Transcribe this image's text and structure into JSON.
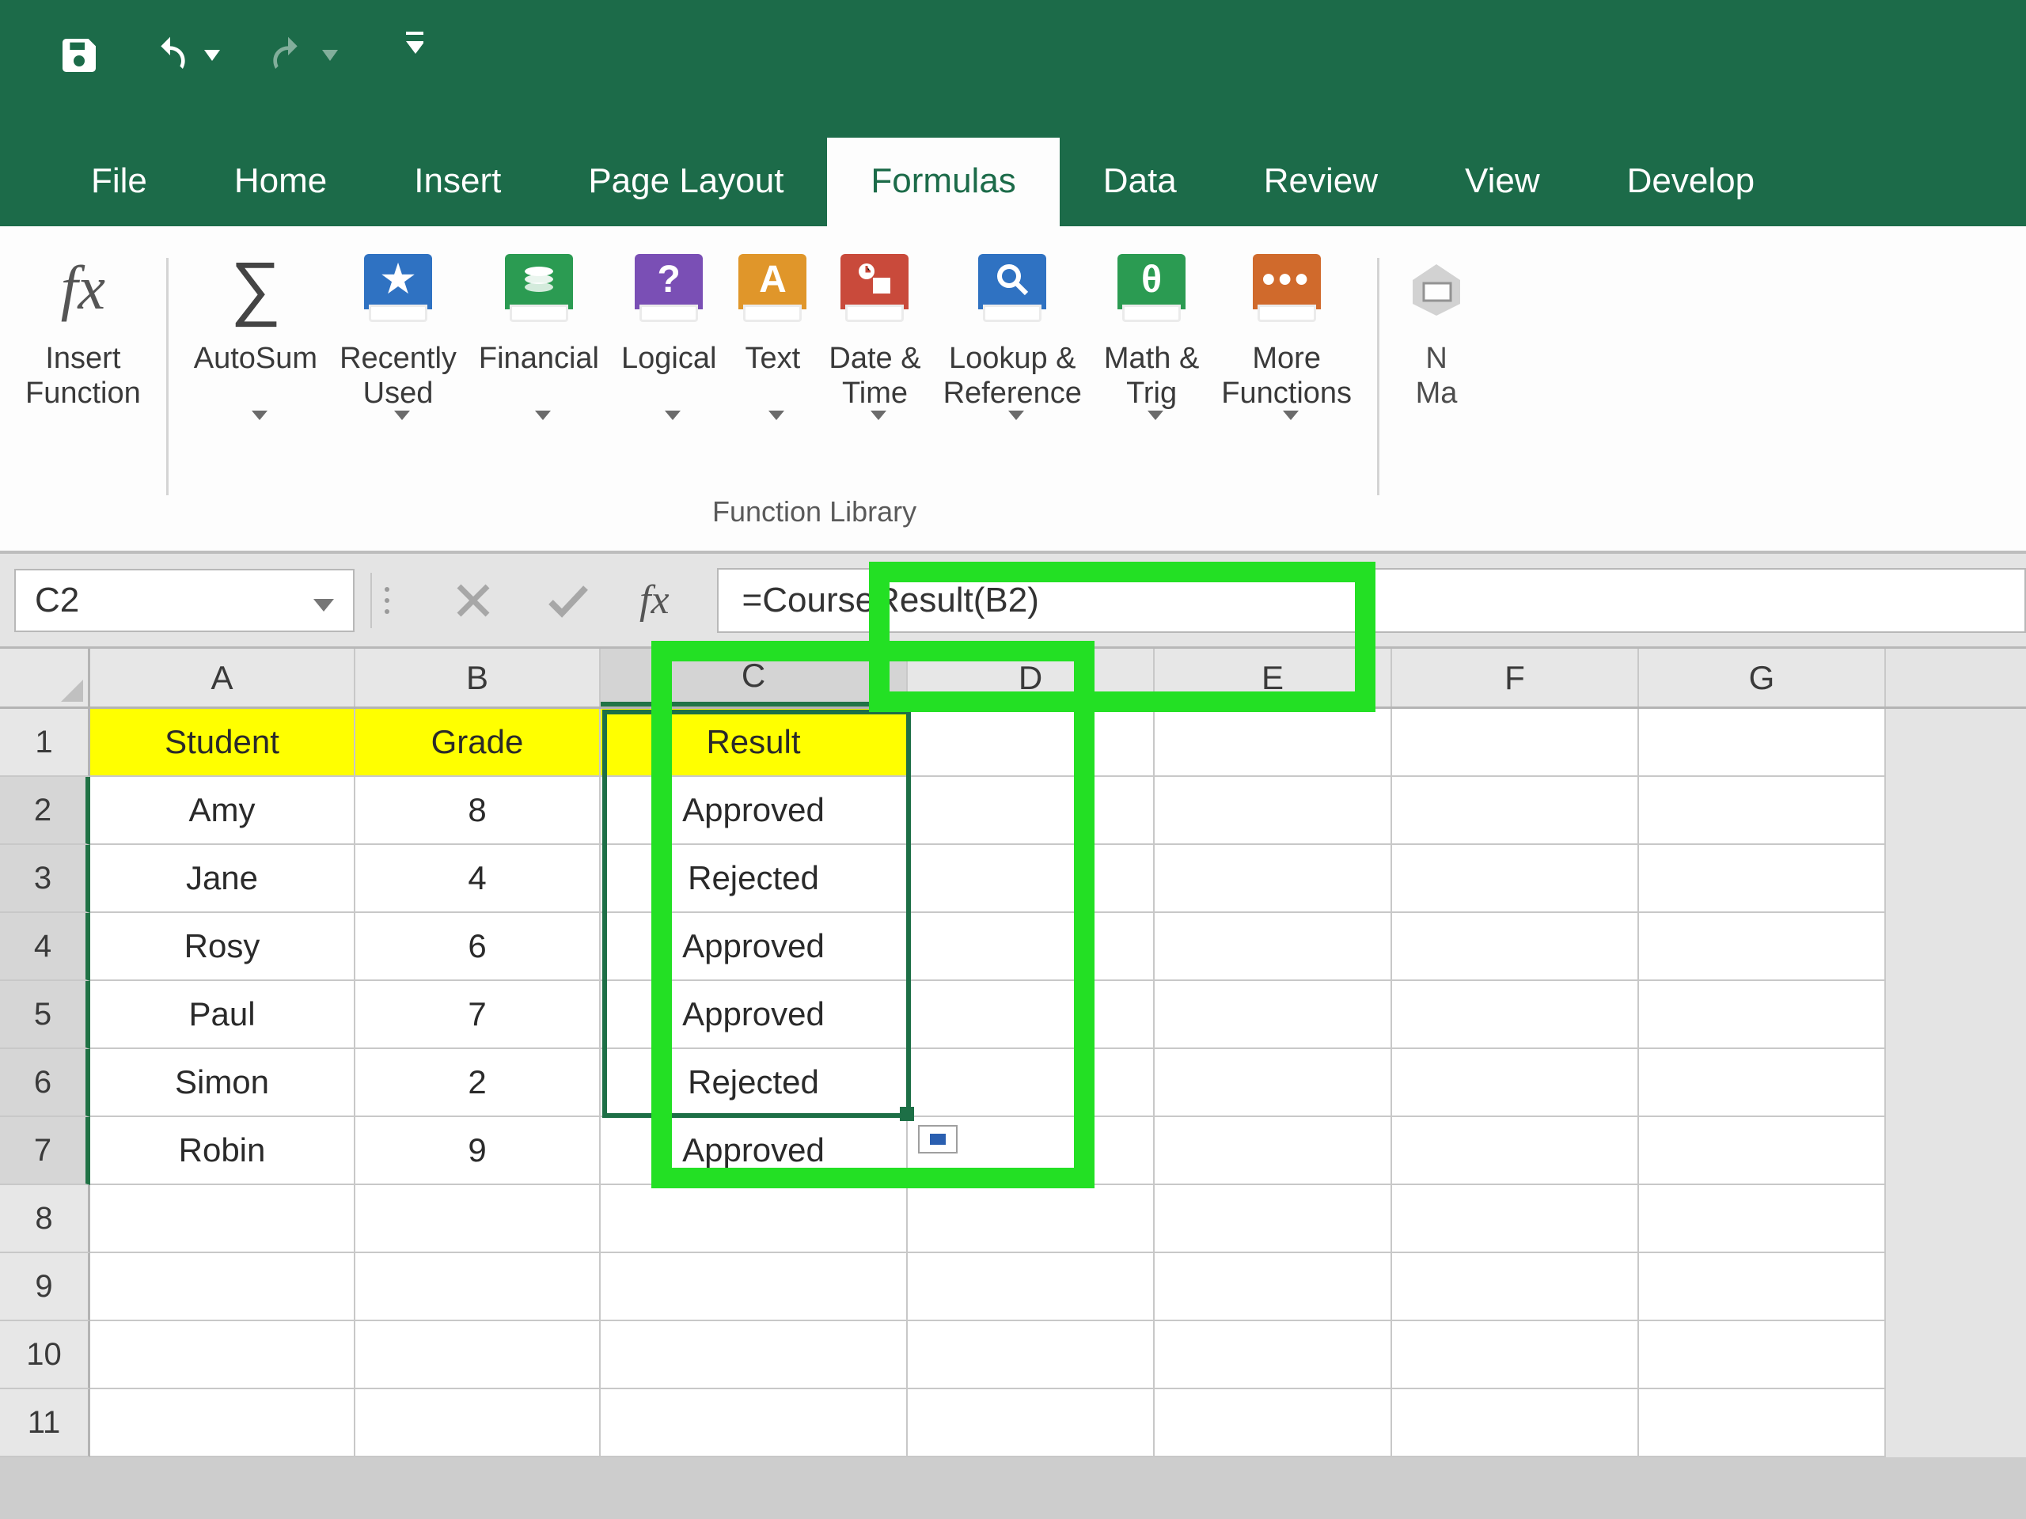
{
  "qat": {
    "save": "Save",
    "undo": "Undo",
    "redo": "Redo",
    "customize": "Customize Quick Access Toolbar"
  },
  "tabs": {
    "file": "File",
    "home": "Home",
    "insert": "Insert",
    "page_layout": "Page Layout",
    "formulas": "Formulas",
    "data": "Data",
    "review": "Review",
    "view": "View",
    "developer": "Develop"
  },
  "active_tab": "formulas",
  "ribbon": {
    "group_label": "Function Library",
    "buttons": {
      "insert_function": "Insert\nFunction",
      "autosum": "AutoSum",
      "recently_used": "Recently\nUsed",
      "financial": "Financial",
      "logical": "Logical",
      "text": "Text",
      "date_time": "Date &\nTime",
      "lookup_ref": "Lookup &\nReference",
      "math_trig": "Math &\nTrig",
      "more_functions": "More\nFunctions",
      "name_manager": "N\nMa"
    },
    "icon_colors": {
      "recently_used": "#2f72c2",
      "financial": "#2b9b52",
      "logical": "#7a4fb5",
      "text": "#e0962a",
      "date_time": "#c94a3b",
      "lookup_ref": "#2f72c2",
      "math_trig": "#2b9b52",
      "more_functions": "#d06a2c"
    }
  },
  "namebox": "C2",
  "formula": "=CourseResult(B2)",
  "columns": [
    "A",
    "B",
    "C",
    "D",
    "E",
    "F",
    "G"
  ],
  "row_numbers": [
    "1",
    "2",
    "3",
    "4",
    "5",
    "6",
    "7",
    "8",
    "9",
    "10",
    "11"
  ],
  "headers": {
    "A": "Student",
    "B": "Grade",
    "C": "Result"
  },
  "rows": [
    {
      "A": "Amy",
      "B": "8",
      "C": "Approved"
    },
    {
      "A": "Jane",
      "B": "4",
      "C": "Rejected"
    },
    {
      "A": "Rosy",
      "B": "6",
      "C": "Approved"
    },
    {
      "A": "Paul",
      "B": "7",
      "C": "Approved"
    },
    {
      "A": "Simon",
      "B": "2",
      "C": "Rejected"
    },
    {
      "A": "Robin",
      "B": "9",
      "C": "Approved"
    }
  ],
  "selection": "C2:C7",
  "chart_data": {
    "type": "table",
    "columns": [
      "Student",
      "Grade",
      "Result"
    ],
    "rows": [
      [
        "Amy",
        8,
        "Approved"
      ],
      [
        "Jane",
        4,
        "Rejected"
      ],
      [
        "Rosy",
        6,
        "Approved"
      ],
      [
        "Paul",
        7,
        "Approved"
      ],
      [
        "Simon",
        2,
        "Rejected"
      ],
      [
        "Robin",
        9,
        "Approved"
      ]
    ]
  }
}
